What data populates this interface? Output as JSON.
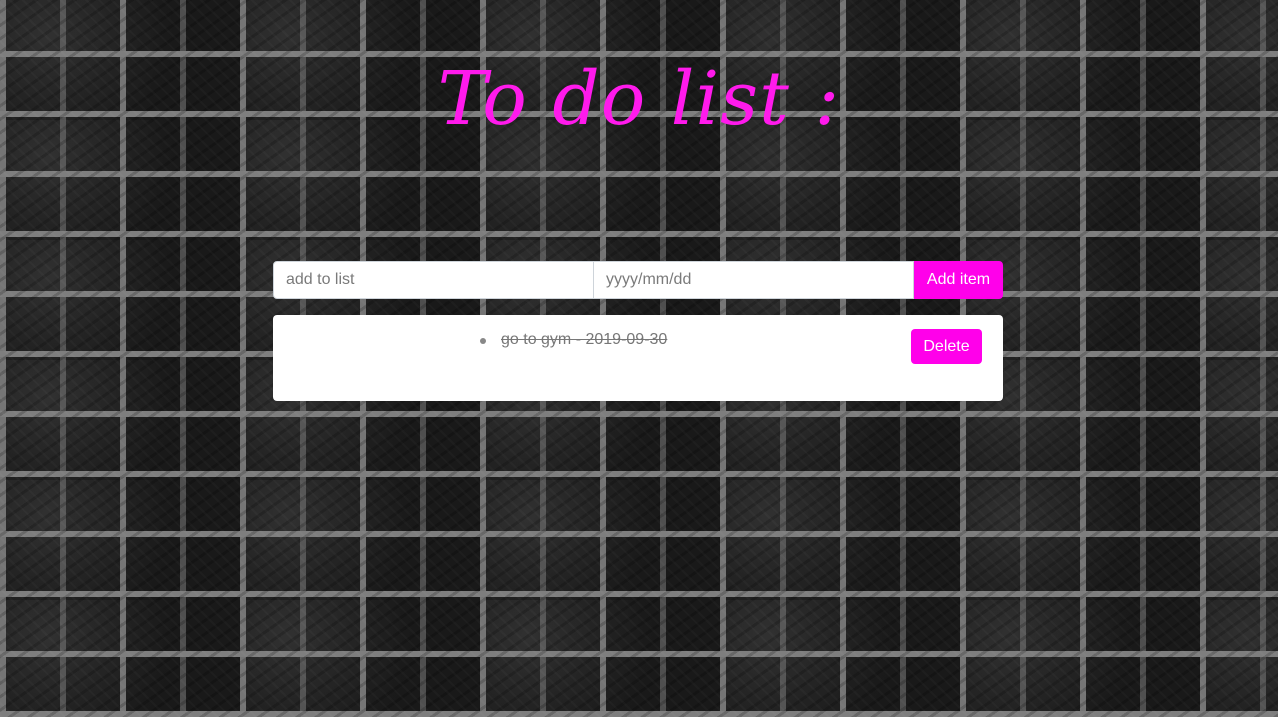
{
  "header": {
    "title": "To do list :"
  },
  "form": {
    "task_placeholder": "add to list",
    "task_value": "",
    "date_placeholder": "yyyy/mm/dd",
    "date_value": "",
    "add_label": "Add item"
  },
  "todos": [
    {
      "text": "go to gym - 2019-09-30",
      "completed": true,
      "delete_label": "Delete"
    }
  ],
  "colors": {
    "accent": "#ff00ea",
    "title": "#ff1aec",
    "card": "#ffffff"
  },
  "icons": {
    "bullet": "bullet-dot-icon"
  }
}
